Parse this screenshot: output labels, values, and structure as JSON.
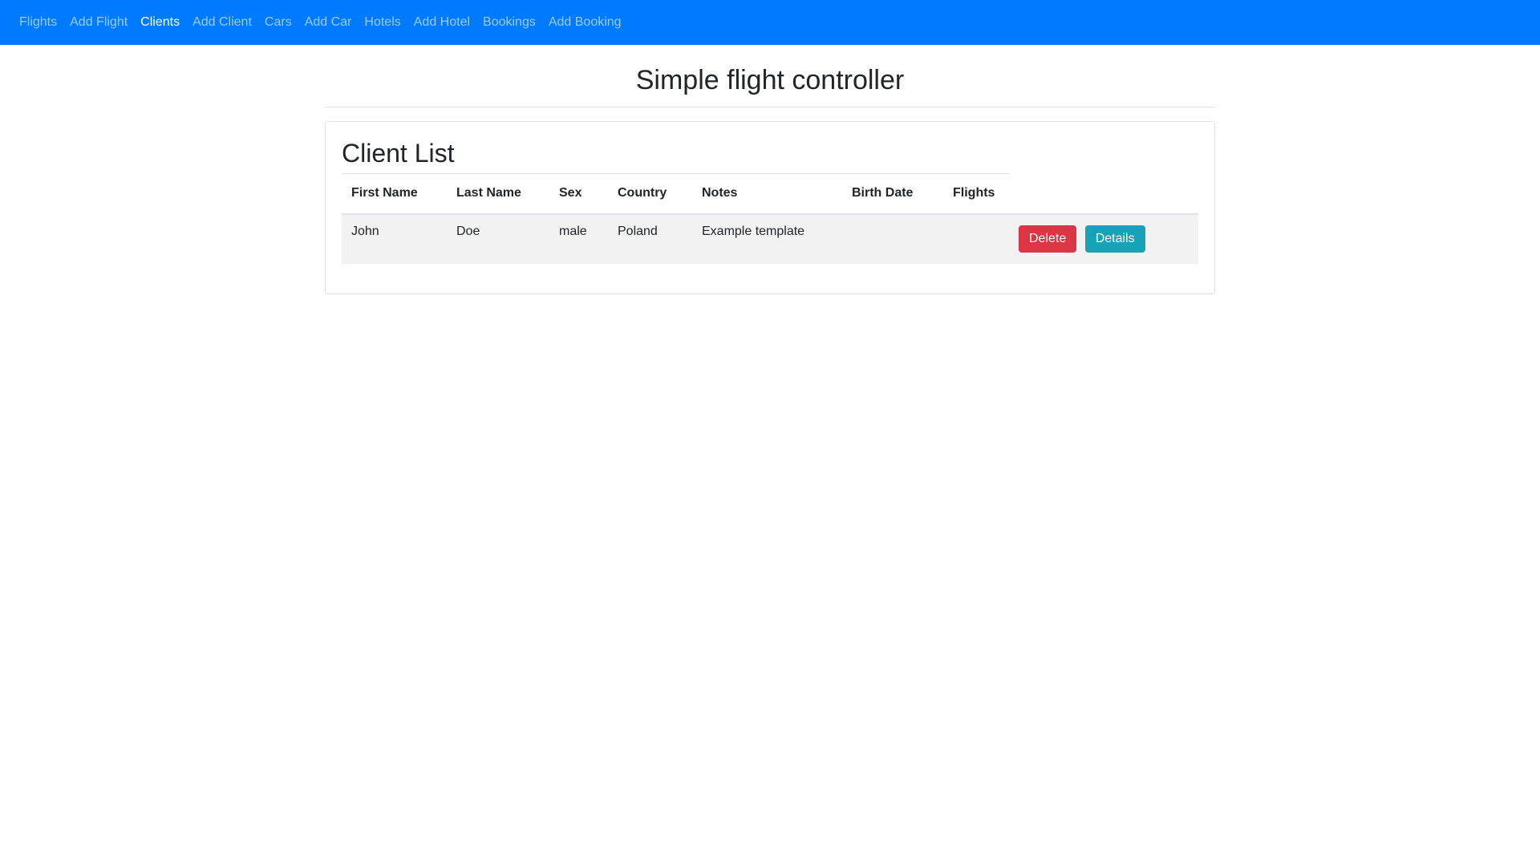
{
  "nav": {
    "items": [
      {
        "label": "Flights",
        "active": false
      },
      {
        "label": "Add Flight",
        "active": false
      },
      {
        "label": "Clients",
        "active": true
      },
      {
        "label": "Add Client",
        "active": false
      },
      {
        "label": "Cars",
        "active": false
      },
      {
        "label": "Add Car",
        "active": false
      },
      {
        "label": "Hotels",
        "active": false
      },
      {
        "label": "Add Hotel",
        "active": false
      },
      {
        "label": "Bookings",
        "active": false
      },
      {
        "label": "Add Booking",
        "active": false
      }
    ]
  },
  "header": {
    "title": "Simple flight controller"
  },
  "clients": {
    "title": "Client List",
    "columns": [
      "First Name",
      "Last Name",
      "Sex",
      "Country",
      "Notes",
      "Birth Date",
      "Flights"
    ],
    "rows": [
      {
        "first_name": "John",
        "last_name": "Doe",
        "sex": "male",
        "country": "Poland",
        "notes": "Example template",
        "birth_date": "",
        "flights": "",
        "delete_label": "Delete",
        "details_label": "Details"
      }
    ]
  },
  "colors": {
    "navbar": "#007bff",
    "delete": "#dc3545",
    "details": "#17a2b8"
  }
}
